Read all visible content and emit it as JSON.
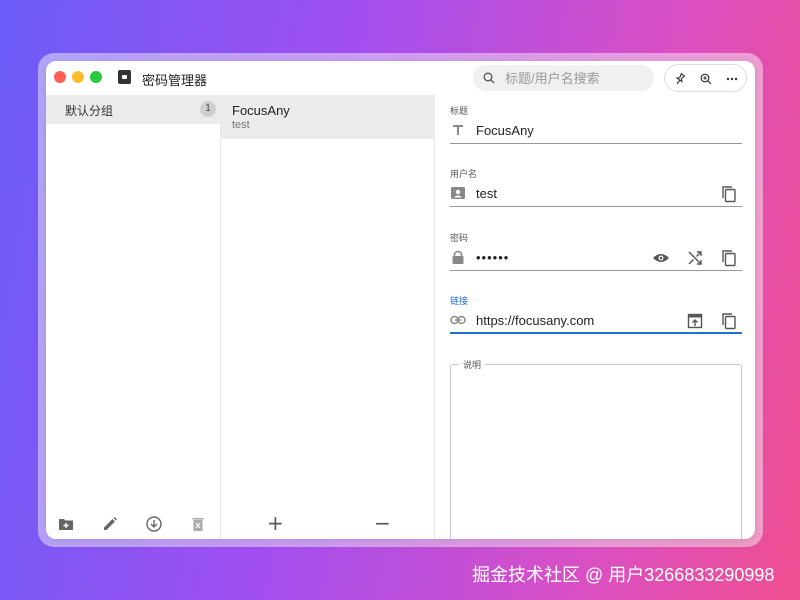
{
  "window": {
    "title": "密码管理器",
    "search_placeholder": "标题/用户名搜索"
  },
  "groups": [
    {
      "label": "默认分组",
      "count": "1"
    }
  ],
  "entries": [
    {
      "title": "FocusAny",
      "subtitle": "test"
    }
  ],
  "detail": {
    "title_label": "标题",
    "title_value": "FocusAny",
    "username_label": "用户名",
    "username_value": "test",
    "password_label": "密码",
    "password_value": "••••••",
    "link_label": "链接",
    "link_value": "https://focusany.com",
    "notes_label": "说明"
  },
  "list_footer": {
    "add": "+",
    "remove": "−"
  },
  "watermark": "掘金技术社区 @ 用户3266833290998",
  "colors": {
    "accent": "#1e6fd1",
    "close": "#fe5f57",
    "minimize": "#febc2e",
    "maximize": "#28c840"
  },
  "icons": [
    "search-icon",
    "pin-icon",
    "zoom-in-icon",
    "more-icon",
    "text-icon",
    "user-icon",
    "lock-icon",
    "link-icon",
    "copy-icon",
    "eye-icon",
    "shuffle-icon",
    "open-link-icon",
    "add-folder-icon",
    "edit-icon",
    "download-icon",
    "delete-icon"
  ]
}
